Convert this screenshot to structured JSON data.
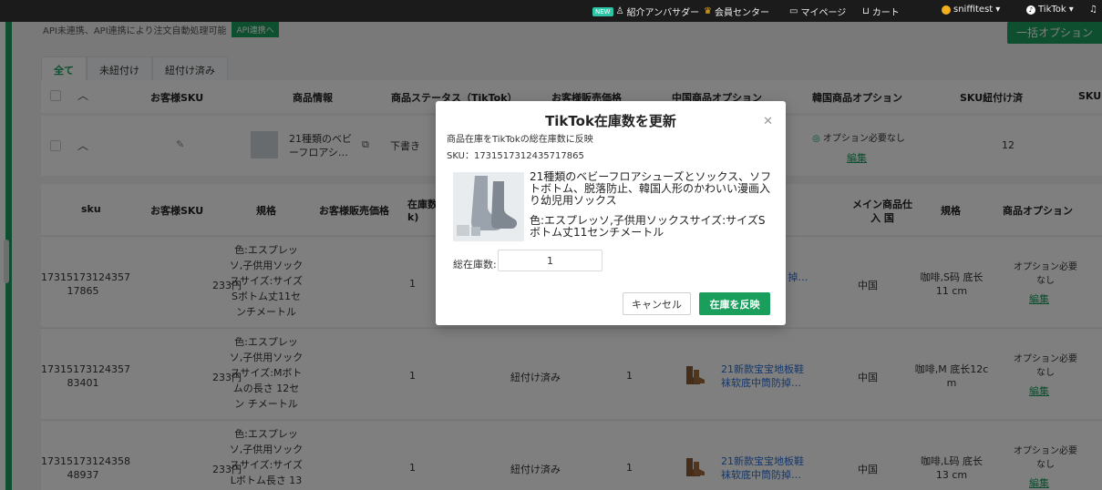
{
  "topbar": {
    "new_badge": "NEW",
    "ambassador": "紹介アンバサダー",
    "member_center": "会員センター",
    "my_page": "マイページ",
    "cart": "カート",
    "user": "sniffitest",
    "platform": "TikTok"
  },
  "notice": {
    "text": "API未連携、API連携により注文自動処理可能",
    "button": "API連携へ"
  },
  "bulk_option_button": "一括オプション",
  "tabs": [
    "全て",
    "未紐付け",
    "紐付け済み"
  ],
  "table_headers": [
    "お客様SKU",
    "商品情報",
    "商品ステータス（TikTok）",
    "お客様販売価格",
    "中国商品オプション",
    "韓国商品オプション",
    "SKU紐付け済",
    "SKU"
  ],
  "product_row": {
    "name": "21種類のベビ ーフロアシ…",
    "status": "下書き",
    "korean_option": "オプション必要なし",
    "edit": "編集",
    "linked_count": "12"
  },
  "sku_headers": {
    "sku": "sku",
    "customer_sku": "お客様SKU",
    "spec": "規格",
    "price": "お客様販売価格",
    "stock": "在庫数 k)",
    "origin": "メイン商品仕入 国",
    "spec2": "規格",
    "option": "商品オプション"
  },
  "sku_rows": [
    {
      "sku": "17315173124357 17865",
      "spec": "色:エスプレッ ソ,子供用ソック スサイズ:サイズ Sボトム丈11セ ンチメートル",
      "price": "233円",
      "stock": "1",
      "link_status": "",
      "count": "",
      "product": "板鞋 掉…",
      "origin": "中国",
      "spec2": "咖啡,S码 底长11 cm",
      "option": "オプション必要 なし",
      "edit": "編集"
    },
    {
      "sku": "17315173124357 83401",
      "spec": "色:エスプレッ ソ,子供用ソック スサイズ:Mボト ムの長さ 12セン チメートル",
      "price": "233円",
      "stock": "1",
      "link_status": "紐付け済み",
      "count": "1",
      "product": "21新款宝宝地板鞋 袜软底中筒防掉…",
      "origin": "中国",
      "spec2": "咖啡,M 底长12c m",
      "option": "オプション必要 なし",
      "edit": "編集"
    },
    {
      "sku": "17315173124358 48937",
      "spec": "色:エスプレッ ソ,子供用ソック スサイズ:サイズ Lボトム長さ 13",
      "price": "233円",
      "stock": "1",
      "link_status": "紐付け済み",
      "count": "1",
      "product": "21新款宝宝地板鞋 袜软底中筒防掉…",
      "origin": "中国",
      "spec2": "咖啡,L码 底长13 cm",
      "option": "オプション必要 なし",
      "edit": "編集"
    }
  ],
  "modal": {
    "title": "TikTok在庫数を更新",
    "subtitle": "商品在庫をTikTokの総在庫数に反映",
    "sku_line": "SKU：1731517312435717865",
    "product_name": "21種類のベビーフロアシューズとソックス、ソフトボトム、脱落防止、韓国人形のかわいい漫画入り幼児用ソックス",
    "product_spec": "色:エスプレッソ,子供用ソックスサイズ:サイズSボトム丈11センチメートル",
    "stock_label": "総在庫数:",
    "stock_value": "1",
    "cancel": "キャンセル",
    "apply": "在庫を反映"
  },
  "colors": {
    "brand_green": "#1a9e5c",
    "link_blue": "#2a6fd6"
  }
}
